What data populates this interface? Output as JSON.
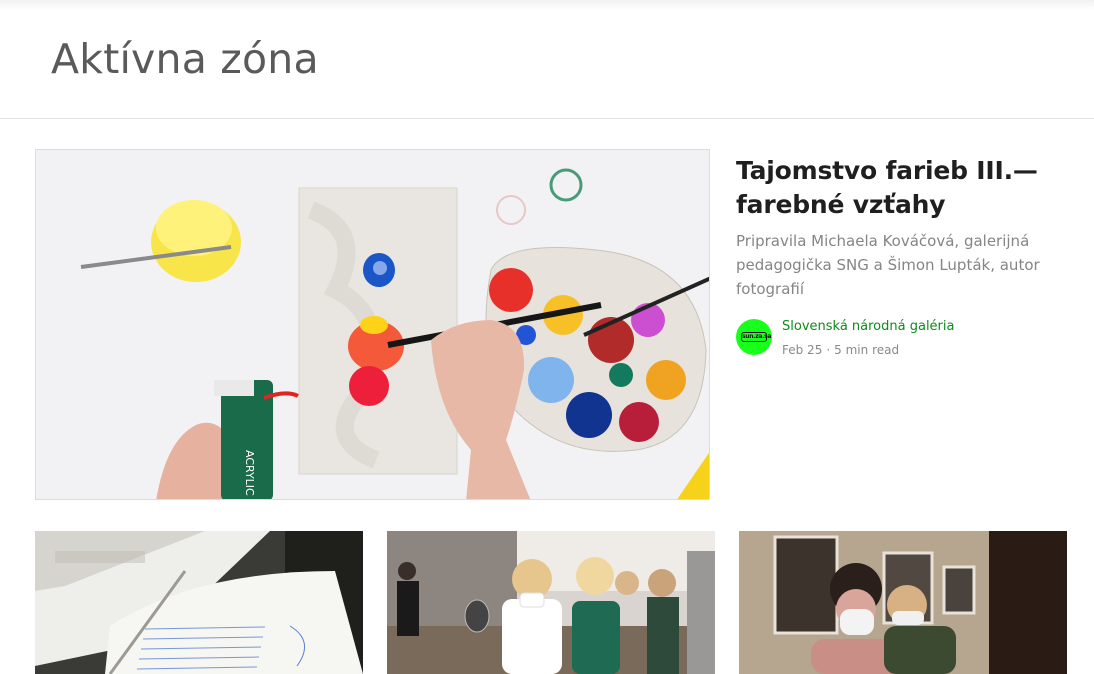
{
  "header": {
    "title": "Aktívna zóna"
  },
  "feature": {
    "title": "Tajomstvo farieb III.— farebné vzťahy",
    "subtitle": "Pripravila Michaela Kováčová, galerijná pedagogička SNG a Šimon Lupták, autor fotografií",
    "publication": "Slovenská národná galéria",
    "avatar_text": "sun.za.sa",
    "date": "Feb 25",
    "separator": "·",
    "read_time": "5 min read",
    "image_icon": "painting-palette-photo",
    "tube_label": "ACRYLIC"
  },
  "cards": [
    {
      "image_icon": "open-book-photo"
    },
    {
      "image_icon": "children-workshop-photo"
    },
    {
      "image_icon": "gallery-visitors-photo"
    }
  ],
  "colors": {
    "title": "#5a5a5a",
    "publication": "#0d8a1a",
    "avatar": "#19ff1c",
    "muted": "#858585"
  }
}
